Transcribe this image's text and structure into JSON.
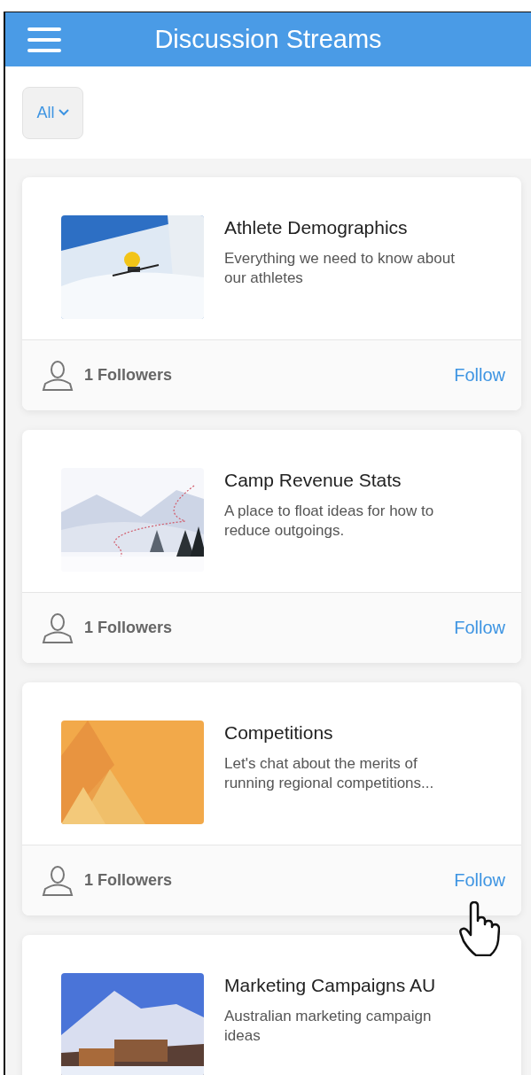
{
  "header": {
    "title": "Discussion Streams"
  },
  "filter": {
    "label": "All"
  },
  "streams": [
    {
      "title": "Athlete Demographics",
      "description": "Everything we need to know about our athletes",
      "followers": "1 Followers",
      "action": "Follow",
      "hovered": false
    },
    {
      "title": "Camp Revenue Stats",
      "description": "A place to float ideas for how to reduce outgoings.",
      "followers": "1 Followers",
      "action": "Follow",
      "hovered": false
    },
    {
      "title": "Competitions",
      "description": "Let's chat about the merits of running regional competitions...",
      "followers": "1 Followers",
      "action": "Follow",
      "hovered": true
    },
    {
      "title": "Marketing Campaigns AU",
      "description": "Australian marketing campaign ideas",
      "hovered": false
    }
  ]
}
